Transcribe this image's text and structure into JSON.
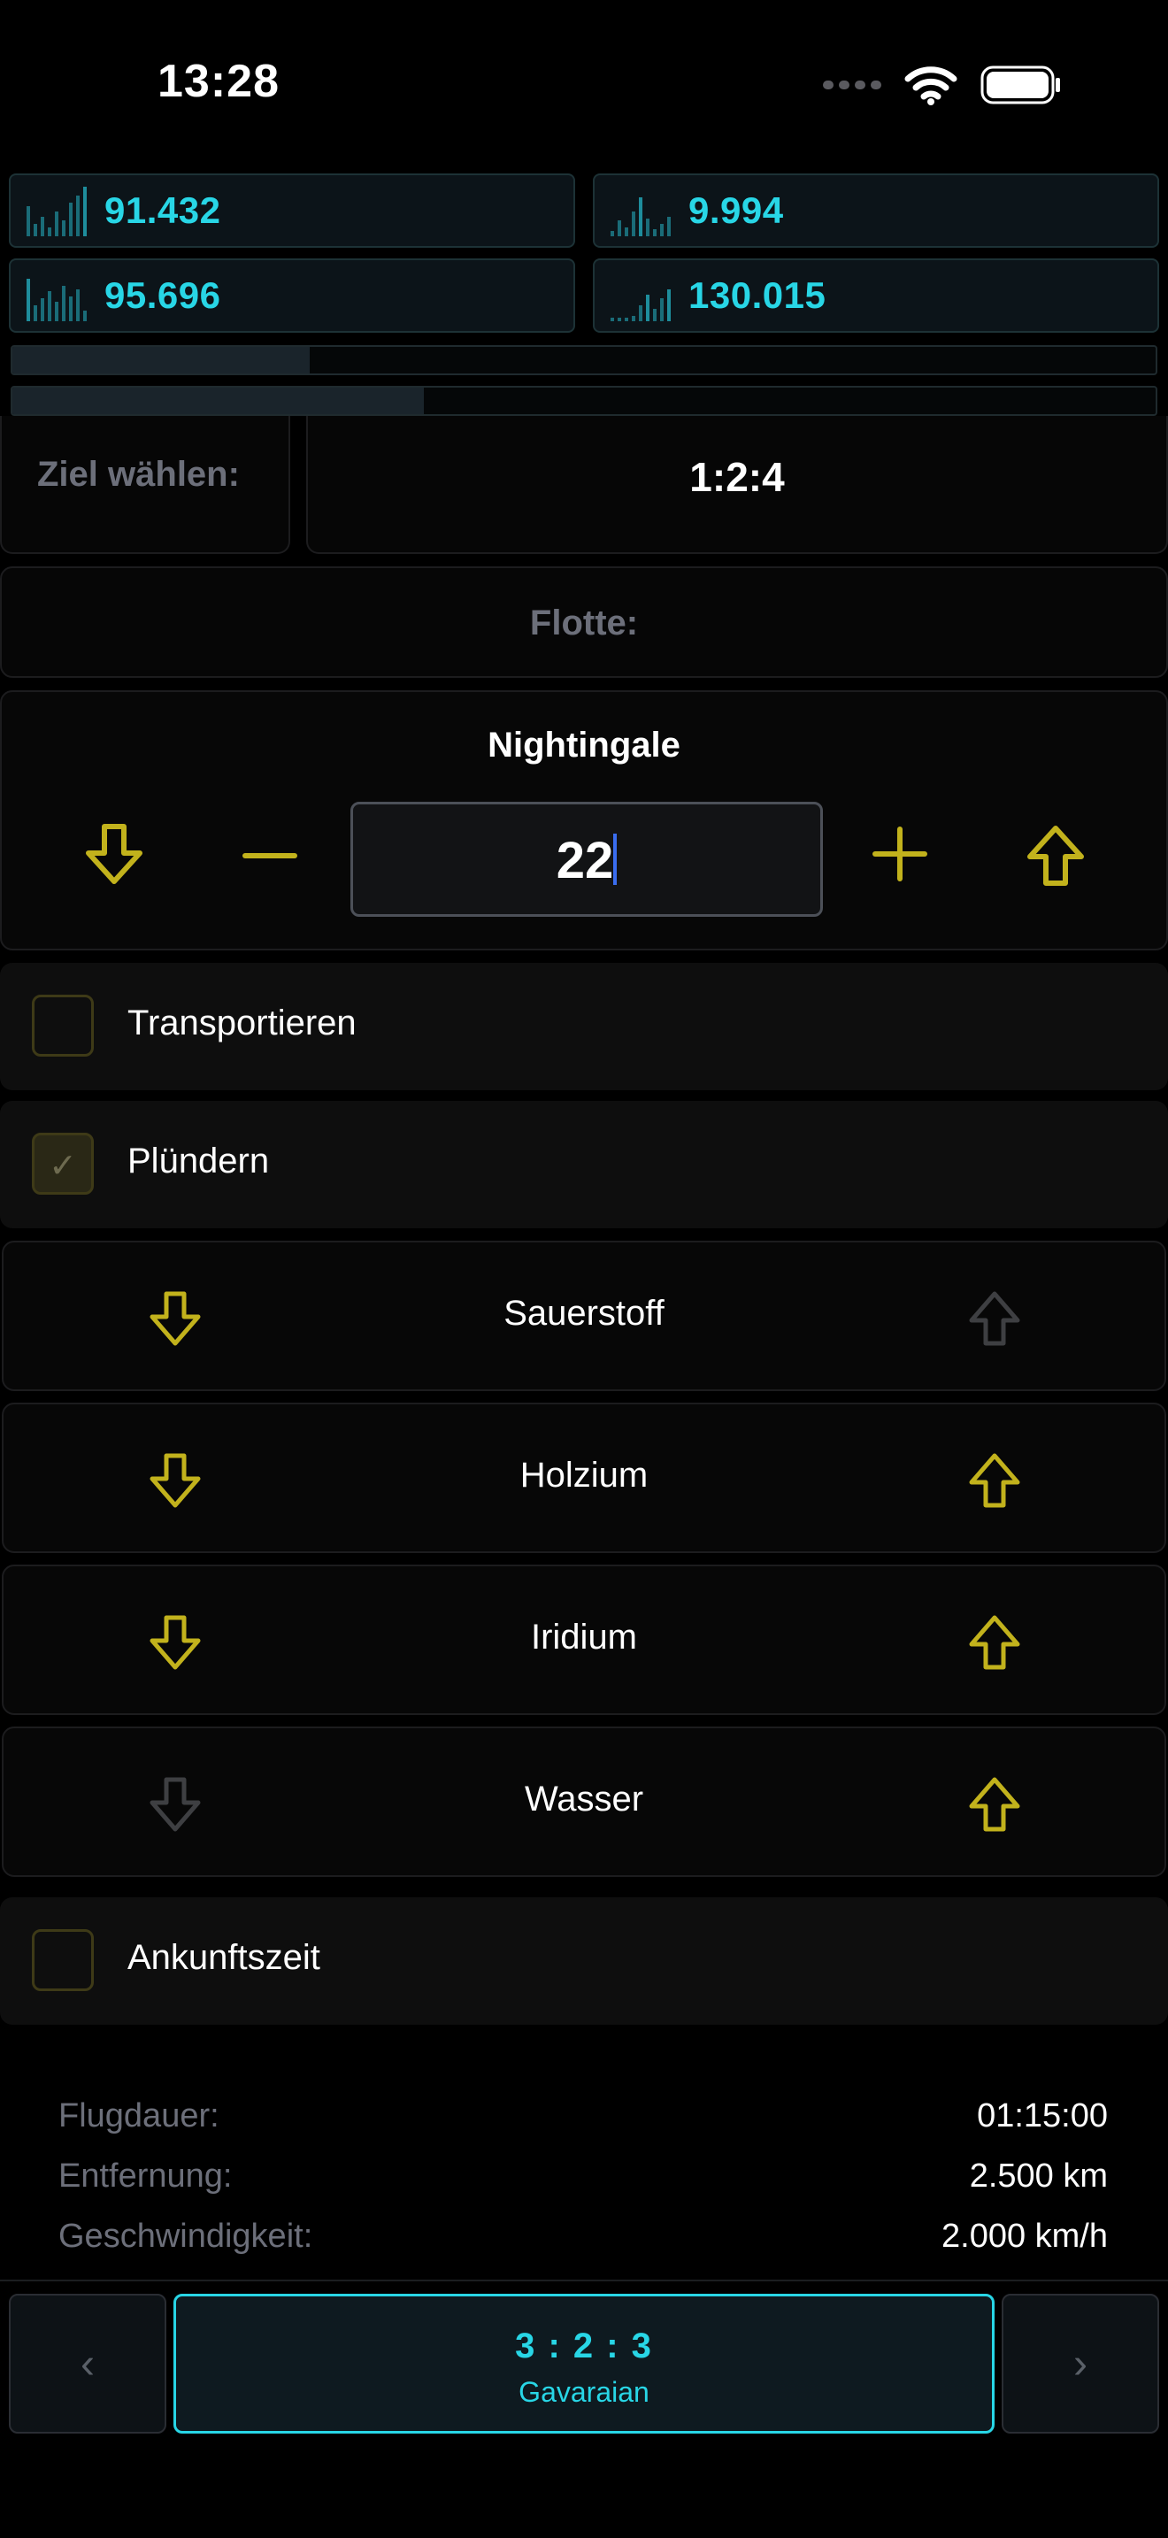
{
  "status_bar": {
    "time": "13:28"
  },
  "resources": [
    {
      "value": "91.432"
    },
    {
      "value": "9.994"
    },
    {
      "value": "95.696"
    },
    {
      "value": "130.015"
    }
  ],
  "progress": [
    {
      "fraction": 0.26
    },
    {
      "fraction": 0.36
    }
  ],
  "target": {
    "label": "Ziel wählen:",
    "coordinates": "1:2:4"
  },
  "fleet": {
    "label": "Flotte:",
    "ship_name": "Nightingale",
    "quantity": "22"
  },
  "options": {
    "transport_label": "Transportieren",
    "transport_checked": false,
    "plunder_label": "Plündern",
    "plunder_checked": true,
    "checkmark": "✓"
  },
  "resources_select": [
    {
      "name": "Sauerstoff",
      "down_active": true,
      "up_active": false
    },
    {
      "name": "Holzium",
      "down_active": true,
      "up_active": true
    },
    {
      "name": "Iridium",
      "down_active": true,
      "up_active": true
    },
    {
      "name": "Wasser",
      "down_active": false,
      "up_active": true
    }
  ],
  "arrival": {
    "label": "Ankunftszeit",
    "checked": false
  },
  "info": {
    "duration_label": "Flugdauer:",
    "duration_value": "01:15:00",
    "distance_label": "Entfernung:",
    "distance_value": "2.500 km",
    "speed_label": "Geschwindigkeit:",
    "speed_value": "2.000 km/h"
  },
  "bottom_nav": {
    "prev": "‹",
    "next": "›",
    "planet_coords": "3 : 2 : 3",
    "planet_name": "Gavaraian"
  },
  "colors": {
    "accent": "#28d6e6",
    "yellow": "#c2b21c",
    "inactive": "#3e3f42"
  }
}
